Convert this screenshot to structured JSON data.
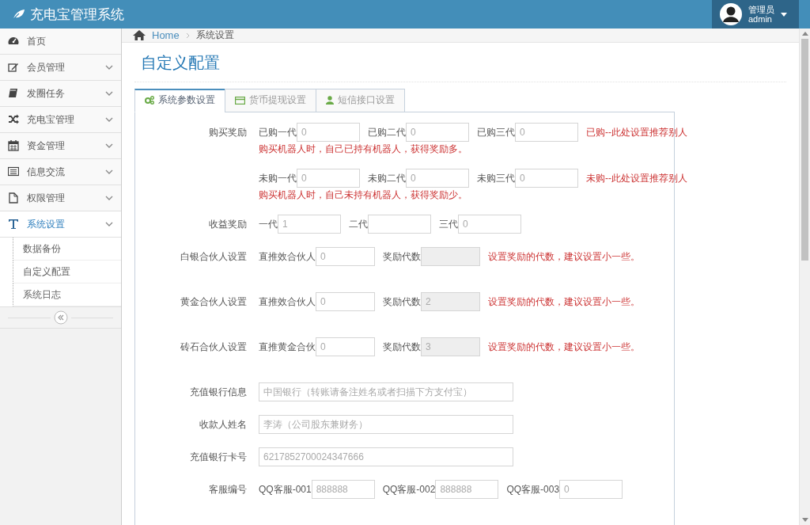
{
  "header": {
    "brand": "充电宝管理系统",
    "user": {
      "role": "管理员",
      "name": "admin"
    }
  },
  "sidebar": {
    "items": [
      {
        "label": "首页",
        "kind": "link",
        "selected": false
      },
      {
        "label": "会员管理",
        "kind": "menu",
        "selected": false
      },
      {
        "label": "发圈任务",
        "kind": "menu",
        "selected": false
      },
      {
        "label": "充电宝管理",
        "kind": "menu",
        "selected": false
      },
      {
        "label": "资金管理",
        "kind": "menu",
        "selected": false
      },
      {
        "label": "信息交流",
        "kind": "menu",
        "selected": false
      },
      {
        "label": "权限管理",
        "kind": "menu",
        "selected": false
      },
      {
        "label": "系统设置",
        "kind": "menu",
        "selected": true,
        "children": [
          {
            "label": "数据备份",
            "selected": false
          },
          {
            "label": "自定义配置",
            "selected": false
          },
          {
            "label": "系统日志",
            "selected": false
          }
        ]
      }
    ]
  },
  "breadcrumb": [
    {
      "label": "Home",
      "kind": "link"
    },
    {
      "label": "系统设置",
      "kind": "text"
    }
  ],
  "page_title": "自定义配置",
  "tabs": [
    {
      "label": "系统参数设置",
      "selected": true
    },
    {
      "label": "货币提现设置",
      "selected": false
    },
    {
      "label": "短信接口设置",
      "selected": false
    }
  ],
  "form": {
    "rows": [
      {
        "kind": "inline",
        "label": "购买奖励",
        "fields": [
          {
            "label": "已购一代",
            "placeholder": "0"
          },
          {
            "label": "已购二代",
            "placeholder": "0"
          },
          {
            "label": "已购三代",
            "placeholder": "0"
          }
        ],
        "note": "已购--此处设置推荐别人",
        "note_2": "购买机器人时，自己已持有机器人，获得奖励多。"
      },
      {
        "kind": "inline",
        "fields": [
          {
            "label": "未购一代",
            "placeholder": "0"
          },
          {
            "label": "未购二代",
            "placeholder": "0"
          },
          {
            "label": "未购三代",
            "placeholder": "0"
          }
        ],
        "note": "未购--此处设置推荐别人",
        "note_2": "购买机器人时，自己未持有机器人，获得奖励少。"
      },
      {
        "kind": "inline",
        "label": "收益奖励",
        "fields": [
          {
            "label": "一代",
            "placeholder": "1"
          },
          {
            "label": "二代"
          },
          {
            "label": "三代",
            "placeholder": "0"
          }
        ]
      },
      {
        "kind": "partner",
        "label": "白银合伙人设置",
        "fields": [
          {
            "label": "直推效合伙人",
            "placeholder": "0"
          },
          {
            "label": "奖励代数",
            "readonly": true
          }
        ],
        "note": "设置奖励的代数，建议设置小一些。"
      },
      {
        "kind": "partner",
        "label": "黄金合伙人设置",
        "fields": [
          {
            "label": "直推效合伙人",
            "placeholder": "0"
          },
          {
            "label": "奖励代数",
            "placeholder": "2",
            "readonly": true
          }
        ],
        "note": "设置奖励的代数，建议设置小一些。"
      },
      {
        "kind": "partner",
        "label": "砖石合伙人设置",
        "fields": [
          {
            "label": "直推黄金合伙",
            "placeholder": "0"
          },
          {
            "label": "奖励代数",
            "placeholder": "3",
            "readonly": true
          }
        ],
        "note": "设置奖励的代数，建议设置小一些。"
      },
      {
        "kind": "wide",
        "label": "充值银行信息",
        "placeholder": "中国银行（转账请备注姓名或者扫描下方支付宝）"
      },
      {
        "kind": "wide",
        "label": "收款人姓名",
        "placeholder": "李涛（公司股东兼财务）"
      },
      {
        "kind": "wide",
        "label": "充值银行卡号",
        "placeholder": "6217852700024347666"
      },
      {
        "kind": "inline",
        "label": "客服编号",
        "fields": [
          {
            "label": "QQ客服-001",
            "placeholder": "888888"
          },
          {
            "label": "QQ客服-002",
            "placeholder": "888888"
          },
          {
            "label": "QQ客服-003",
            "placeholder": "0"
          }
        ]
      }
    ]
  }
}
